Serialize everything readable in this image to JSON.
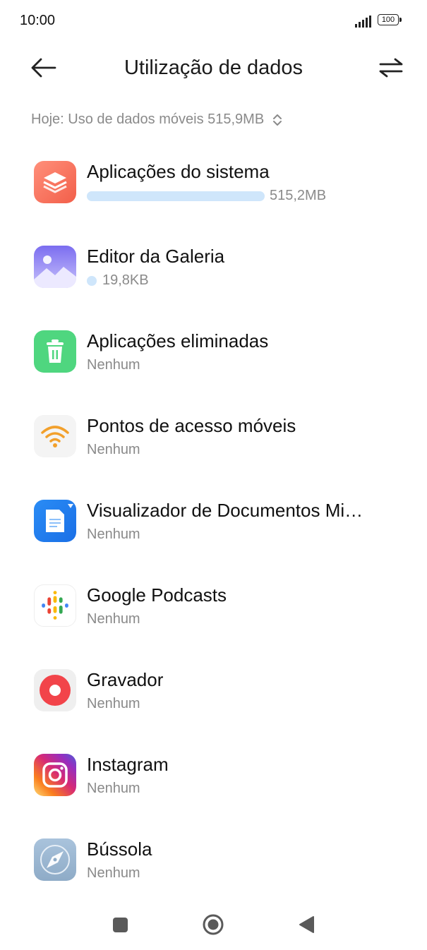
{
  "status_bar": {
    "time": "10:00",
    "battery": "100"
  },
  "header": {
    "title": "Utilização de dados"
  },
  "summary": {
    "text": "Hoje: Uso de dados móveis 515,9MB"
  },
  "apps": [
    {
      "name": "Aplicações do sistema",
      "usage": "515,2MB",
      "icon": "system-apps-icon"
    },
    {
      "name": "Editor da Galeria",
      "usage": "19,8KB",
      "icon": "gallery-editor-icon"
    },
    {
      "name": "Aplicações eliminadas",
      "usage": "Nenhum",
      "icon": "trash-icon"
    },
    {
      "name": "Pontos de acesso móveis",
      "usage": "Nenhum",
      "icon": "hotspot-icon"
    },
    {
      "name": "Visualizador de Documentos Mi…",
      "usage": "Nenhum",
      "icon": "document-viewer-icon"
    },
    {
      "name": "Google Podcasts",
      "usage": "Nenhum",
      "icon": "podcasts-icon"
    },
    {
      "name": "Gravador",
      "usage": "Nenhum",
      "icon": "recorder-icon"
    },
    {
      "name": "Instagram",
      "usage": "Nenhum",
      "icon": "instagram-icon"
    },
    {
      "name": "Bússola",
      "usage": "Nenhum",
      "icon": "compass-icon"
    }
  ],
  "nav": {
    "recents": "recents-icon",
    "home": "home-icon",
    "back": "back-triangle-icon"
  }
}
